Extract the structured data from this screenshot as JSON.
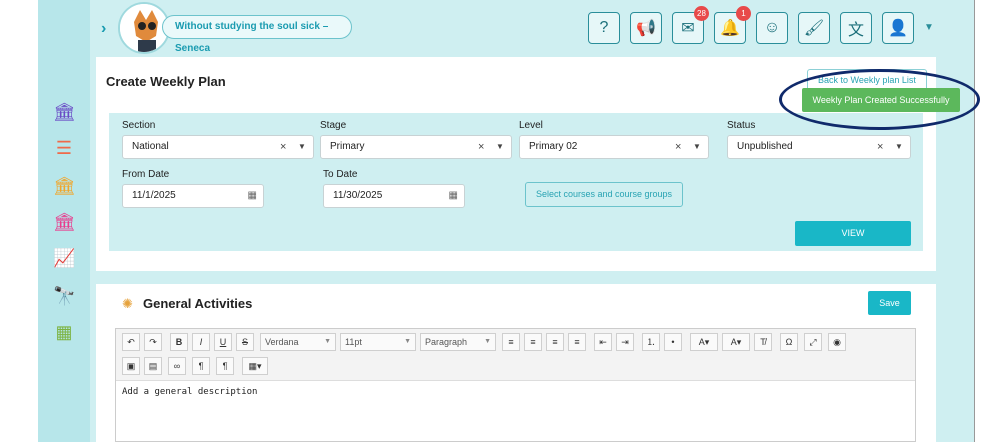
{
  "header": {
    "quote": "Without studying the soul sick – Seneca",
    "messages_badge": "28",
    "notifications_badge": "1"
  },
  "plan": {
    "title": "Create Weekly Plan",
    "back_link": "Back to Weekly plan List",
    "toast": "Weekly Plan Created Successfully"
  },
  "form": {
    "section_label": "Section",
    "section_value": "National",
    "stage_label": "Stage",
    "stage_value": "Primary",
    "level_label": "Level",
    "level_value": "Primary 02",
    "status_label": "Status",
    "status_value": "Unpublished",
    "from_label": "From Date",
    "from_value": "11/1/2025",
    "to_label": "To Date",
    "to_value": "11/30/2025",
    "courses_button": "Select courses and course groups",
    "view_button": "VIEW"
  },
  "activities": {
    "title": "General Activities",
    "save_button": "Save",
    "font_family": "Verdana",
    "font_size": "11pt",
    "block_format": "Paragraph",
    "placeholder": "Add a general description"
  },
  "colors": {
    "accent": "#19b7c7",
    "toast_green": "#5cb85c",
    "highlight_ring": "#102a6b"
  }
}
